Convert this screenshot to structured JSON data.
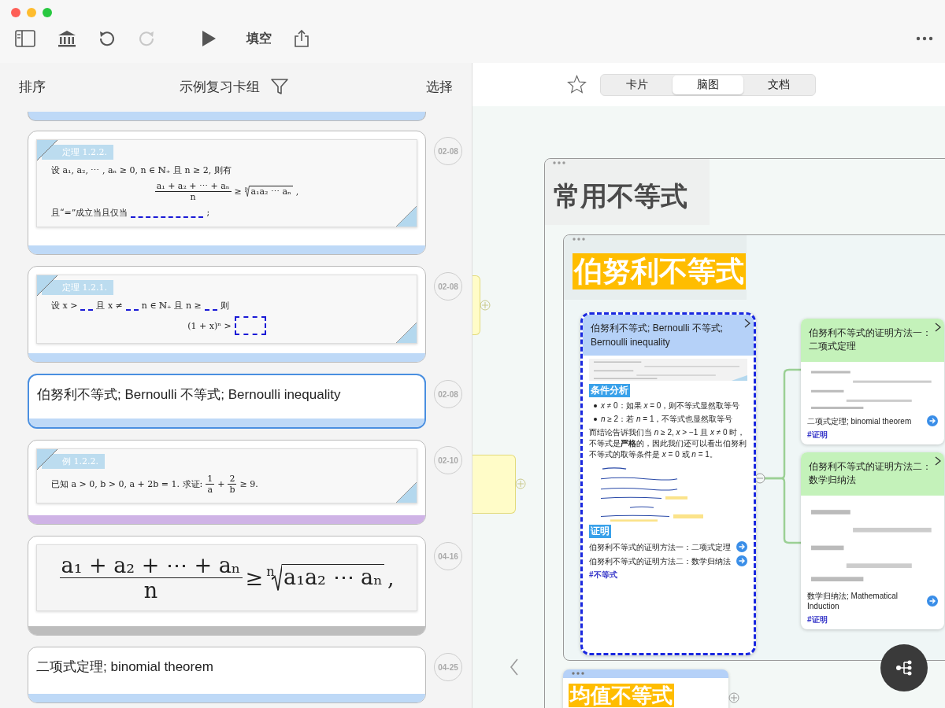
{
  "toolbar": [
    {
      "kind": "sidebar"
    },
    {
      "kind": "library"
    },
    {
      "kind": "undo"
    },
    {
      "kind": "redo",
      "disabled": true
    },
    {
      "kind": "play"
    },
    {
      "kind": "label",
      "text": "填空"
    },
    {
      "kind": "share"
    }
  ],
  "deck": {
    "sort_label": "排序",
    "title": "示例复习卡组",
    "select_label": "选择"
  },
  "cards": [
    {
      "kind": "doc",
      "selected": false,
      "color": "#bed9f7",
      "date": "02-08",
      "tag": "定理 1.2.2.",
      "rows": [
        {
          "kind": "inline",
          "parts": [
            {
              "kind": "text",
              "text": "设 a₁, a₂, ⋯ , aₙ ≥ 0, n ∈ ℕ₊ 且 n ≥ 2, 则有"
            }
          ]
        },
        {
          "kind": "display",
          "parts": [
            {
              "kind": "frac",
              "num": "a₁ + a₂ + ⋯ + aₙ",
              "den": "n"
            },
            {
              "kind": "text",
              "text": "≥"
            },
            {
              "kind": "root",
              "index": "n",
              "text": "a₁a₂ ⋯ aₙ"
            },
            {
              "kind": "text",
              "text": ","
            }
          ]
        },
        {
          "kind": "inline",
          "parts": [
            {
              "kind": "text",
              "text": "且“=”成立当且仅当"
            },
            {
              "kind": "long_blank"
            },
            {
              "kind": "text",
              "text": ";"
            }
          ]
        }
      ]
    },
    {
      "kind": "doc",
      "selected": false,
      "color": "#bed9f7",
      "date": "02-08",
      "tag": "定理 1.2.1.",
      "rows": [
        {
          "kind": "inline",
          "parts": [
            {
              "kind": "text",
              "text": "设 x >"
            },
            {
              "kind": "blank"
            },
            {
              "kind": "text",
              "text": "且 x ≠"
            },
            {
              "kind": "blank"
            },
            {
              "kind": "text",
              "text": "n ∈ ℕ₊ 且 n ≥"
            },
            {
              "kind": "blank"
            },
            {
              "kind": "text",
              "text": "则"
            }
          ]
        },
        {
          "kind": "display",
          "parts": [
            {
              "kind": "text",
              "text": "(1 + x)ⁿ >"
            },
            {
              "kind": "box_blank"
            }
          ]
        }
      ]
    },
    {
      "kind": "text",
      "selected": true,
      "color": "#bed9f7",
      "date": "02-08",
      "text": "伯努利不等式; Bernoulli 不等式; Bernoulli inequality"
    },
    {
      "kind": "doc",
      "selected": false,
      "color": "#cfb3e6",
      "date": "02-10",
      "tag": "例 1.2.2.",
      "rows": [
        {
          "kind": "inline",
          "parts": [
            {
              "kind": "text",
              "text": "已知 a > 0, b > 0, a + 2b = 1. 求证:"
            },
            {
              "kind": "frac",
              "num": "1",
              "den": "a"
            },
            {
              "kind": "text",
              "text": "+"
            },
            {
              "kind": "frac",
              "num": "2",
              "den": "b"
            },
            {
              "kind": "text",
              "text": "≥ 9."
            }
          ]
        }
      ]
    },
    {
      "kind": "formula",
      "selected": false,
      "color": "#bdbdbd",
      "date": "04-16",
      "rows": [
        {
          "kind": "display",
          "parts": [
            {
              "kind": "frac",
              "num": "a₁ + a₂ + ⋯ + aₙ",
              "den": "n"
            },
            {
              "kind": "text",
              "text": "≥"
            },
            {
              "kind": "root",
              "index": "n",
              "text": "a₁a₂ ⋯ aₙ"
            },
            {
              "kind": "text",
              "text": ","
            }
          ]
        }
      ]
    },
    {
      "kind": "text",
      "selected": false,
      "color": "#bed9f7",
      "date": "04-25",
      "text": "二项式定理; binomial theorem"
    }
  ],
  "view_tabs": [
    {
      "label": "卡片",
      "selected": false
    },
    {
      "label": "脑图",
      "selected": true
    },
    {
      "label": "文档",
      "selected": false
    }
  ],
  "mindmap": {
    "frame_title": "常用不等式",
    "topic": "伯努利不等式",
    "node": {
      "title": "伯努利不等式; Bernoulli 不等式; Bernoulli inequality",
      "color": "#b5d1f8",
      "selected": true,
      "sections": [
        {
          "kind": "thumbnail"
        },
        {
          "kind": "heading",
          "text": "条件分析"
        },
        {
          "kind": "bullet",
          "text": "*x* ≠ 0：如果 *x* = 0，则不等式显然取等号"
        },
        {
          "kind": "bullet",
          "text": "*n* ≥ 2：若 *n* = 1，不等式也显然取等号"
        },
        {
          "kind": "paragraph",
          "text": "而结论告诉我们当 *n* ≥ 2, *x* > −1 且 *x* ≠ 0 时，不等式是**严格**的，因此我们还可以看出伯努利不等式的取等条件是 *x* = 0 或 *n* = 1。"
        },
        {
          "kind": "sketch"
        },
        {
          "kind": "heading",
          "text": "证明"
        },
        {
          "kind": "link",
          "text": "伯努利不等式的证明方法一：二项式定理"
        },
        {
          "kind": "link",
          "text": "伯努利不等式的证明方法二：数学归纳法"
        },
        {
          "kind": "tag",
          "text": "#不等式"
        }
      ]
    },
    "branches": [
      {
        "title": "伯努利不等式的证明方法一：二项式定理",
        "color": "#c4f2ba",
        "selected": false,
        "sections": [
          {
            "kind": "thumbnail"
          },
          {
            "kind": "link",
            "text": "二项式定理; binomial theorem"
          },
          {
            "kind": "tag",
            "text": "#证明"
          }
        ]
      },
      {
        "title": "伯努利不等式的证明方法二：数学归纳法",
        "color": "#c4f2ba",
        "selected": false,
        "sections": [
          {
            "kind": "thumbnail"
          },
          {
            "kind": "link",
            "text": "数学归纳法; Mathematical Induction"
          },
          {
            "kind": "tag",
            "text": "#证明"
          }
        ]
      }
    ],
    "next_topic": "均值不等式"
  }
}
